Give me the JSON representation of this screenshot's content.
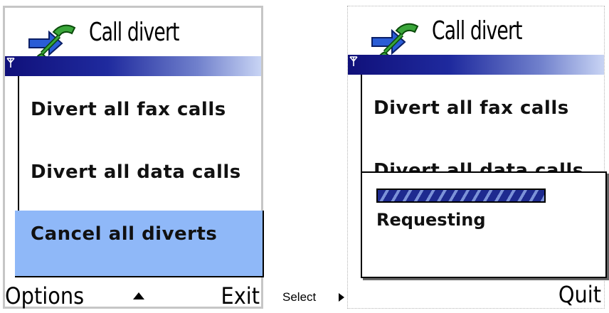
{
  "screens": [
    {
      "header": {
        "title": "Call divert",
        "icon": "call-divert-icon"
      },
      "menu": {
        "items": [
          {
            "label": "Divert all fax calls"
          },
          {
            "label": "Divert all data calls"
          },
          {
            "label": "Cancel all diverts",
            "selected": true
          }
        ]
      },
      "softkeys": {
        "left": "Options",
        "center_icon": "up-arrow-icon",
        "right": "Exit"
      }
    },
    {
      "header": {
        "title": "Call divert",
        "icon": "call-divert-icon"
      },
      "menu": {
        "items": [
          {
            "label": "Divert all fax calls"
          },
          {
            "label": "Divert all data calls"
          }
        ]
      },
      "dialog": {
        "message": "Requesting",
        "progress": 1.0
      },
      "softkeys": {
        "right": "Quit"
      }
    }
  ],
  "transition": {
    "label": "Select",
    "icon": "right-arrow-icon"
  },
  "colors": {
    "highlight": "#8fb8f8",
    "bar_dark": "#10107a",
    "bar_light": "#c8d4f4",
    "progress_dark": "#1e2a8f",
    "progress_light": "#7c92d8"
  }
}
